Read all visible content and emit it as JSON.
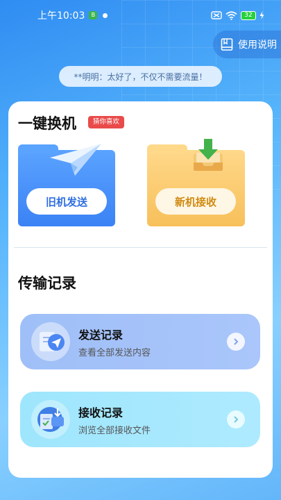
{
  "status_bar": {
    "time": "上午10:03",
    "mini_badge": "B",
    "battery": "32",
    "icons": [
      "signal-off-icon",
      "wifi-icon",
      "battery-icon",
      "charging-icon"
    ]
  },
  "header": {
    "manual_label": "使用说明",
    "manual_icon": "bookmark-icon"
  },
  "notice": {
    "text": "**明明：太好了，不仅不需要流量！"
  },
  "one_click": {
    "title": "一键换机",
    "tag": "猜你喜欢",
    "old_phone_label": "旧机发送",
    "new_phone_label": "新机接收"
  },
  "records": {
    "title": "传输记录",
    "send": {
      "title": "发送记录",
      "subtitle": "查看全部发送内容"
    },
    "receive": {
      "title": "接收记录",
      "subtitle": "浏览全部接收文件"
    }
  },
  "colors": {
    "brand_blue": "#3b82f5",
    "accent_orange": "#f7c05a",
    "tag_red": "#e94a4a"
  }
}
